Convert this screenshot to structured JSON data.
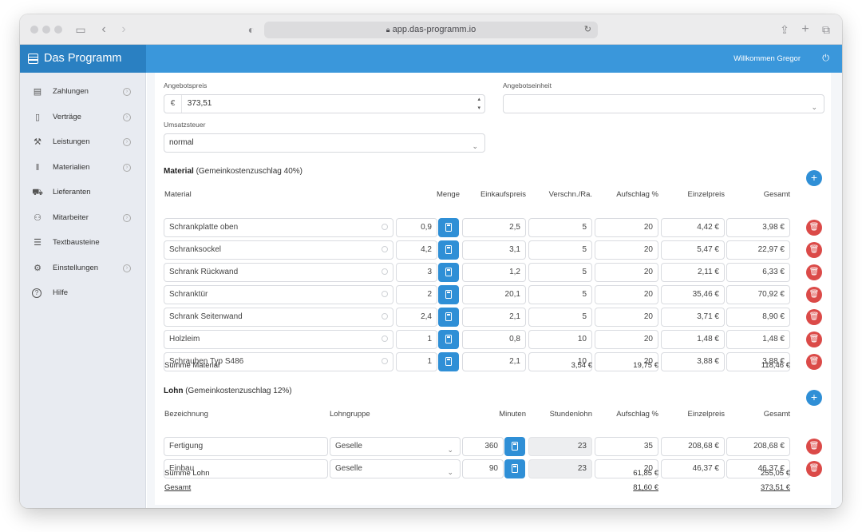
{
  "browser": {
    "url": "app.das-programm.io"
  },
  "app": {
    "brand": "Das Programm",
    "welcome": "Willkommen Gregor"
  },
  "sidebar": {
    "items": [
      {
        "label": "Zahlungen",
        "icon": "cash-register-icon",
        "expandable": true
      },
      {
        "label": "Verträge",
        "icon": "document-icon",
        "expandable": true
      },
      {
        "label": "Leistungen",
        "icon": "hammer-icon",
        "expandable": true
      },
      {
        "label": "Materialien",
        "icon": "barcode-icon",
        "expandable": true
      },
      {
        "label": "Lieferanten",
        "icon": "truck-icon",
        "expandable": false
      },
      {
        "label": "Mitarbeiter",
        "icon": "people-icon",
        "expandable": true
      },
      {
        "label": "Textbausteine",
        "icon": "text-document-icon",
        "expandable": false
      },
      {
        "label": "Einstellungen",
        "icon": "gears-icon",
        "expandable": true
      },
      {
        "label": "Hilfe",
        "icon": "question-icon",
        "expandable": false
      }
    ]
  },
  "form": {
    "angebotspreis_label": "Angebotspreis",
    "currency_symbol": "€",
    "angebotspreis_value": "373,51",
    "angebotseinheit_label": "Angebotseinheit",
    "angebotseinheit_value": "",
    "umsatzsteuer_label": "Umsatzsteuer",
    "umsatzsteuer_value": "normal"
  },
  "material": {
    "title": "Material",
    "subtitle": "(Gemeinkostenzuschlag 40%)",
    "columns": [
      "Material",
      "Menge",
      "Einkaufspreis",
      "Verschn./Ra.",
      "Aufschlag %",
      "Einzelpreis",
      "Gesamt"
    ],
    "rows": [
      {
        "name": "Schrankplatte oben",
        "menge": "0,9",
        "einkauf": "2,5",
        "verschnitt": "5",
        "aufschlag": "20",
        "einzel": "4,42 €",
        "gesamt": "3,98 €"
      },
      {
        "name": "Schranksockel",
        "menge": "4,2",
        "einkauf": "3,1",
        "verschnitt": "5",
        "aufschlag": "20",
        "einzel": "5,47 €",
        "gesamt": "22,97 €"
      },
      {
        "name": "Schrank Rückwand",
        "menge": "3",
        "einkauf": "1,2",
        "verschnitt": "5",
        "aufschlag": "20",
        "einzel": "2,11 €",
        "gesamt": "6,33 €"
      },
      {
        "name": "Schranktür",
        "menge": "2",
        "einkauf": "20,1",
        "verschnitt": "5",
        "aufschlag": "20",
        "einzel": "35,46 €",
        "gesamt": "70,92 €"
      },
      {
        "name": "Schrank Seitenwand",
        "menge": "2,4",
        "einkauf": "2,1",
        "verschnitt": "5",
        "aufschlag": "20",
        "einzel": "3,71 €",
        "gesamt": "8,90 €"
      },
      {
        "name": "Holzleim",
        "menge": "1",
        "einkauf": "0,8",
        "verschnitt": "10",
        "aufschlag": "20",
        "einzel": "1,48 €",
        "gesamt": "1,48 €"
      },
      {
        "name": "Schrauben Typ S486",
        "menge": "1",
        "einkauf": "2,1",
        "verschnitt": "10",
        "aufschlag": "20",
        "einzel": "3,88 €",
        "gesamt": "3,88 €"
      }
    ],
    "sum_label": "Summe Material",
    "sum_verschnitt": "3,54 €",
    "sum_aufschlag": "19,75 €",
    "sum_gesamt": "118,46 €"
  },
  "lohn": {
    "title": "Lohn",
    "subtitle": "(Gemeinkostenzuschlag 12%)",
    "columns": [
      "Bezeichnung",
      "Lohngruppe",
      "Minuten",
      "Stundenlohn",
      "Aufschlag %",
      "Einzelpreis",
      "Gesamt"
    ],
    "rows": [
      {
        "name": "Fertigung",
        "gruppe": "Geselle",
        "minuten": "360",
        "stundenlohn": "23",
        "aufschlag": "35",
        "einzel": "208,68 €",
        "gesamt": "208,68 €"
      },
      {
        "name": "Einbau",
        "gruppe": "Geselle",
        "minuten": "90",
        "stundenlohn": "23",
        "aufschlag": "20",
        "einzel": "46,37 €",
        "gesamt": "46,37 €"
      }
    ],
    "sum_label": "Summe Lohn",
    "sum_aufschlag": "61,85 €",
    "sum_gesamt": "255,05 €",
    "total_label": "Gesamt",
    "total_aufschlag": "81,60 €",
    "total_gesamt": "373,51 €"
  },
  "colors": {
    "header": "#3a97db",
    "brand": "#2a80c2",
    "accent": "#2f8fd6",
    "danger": "#db4a48",
    "sidebar": "#e8ebf1"
  }
}
